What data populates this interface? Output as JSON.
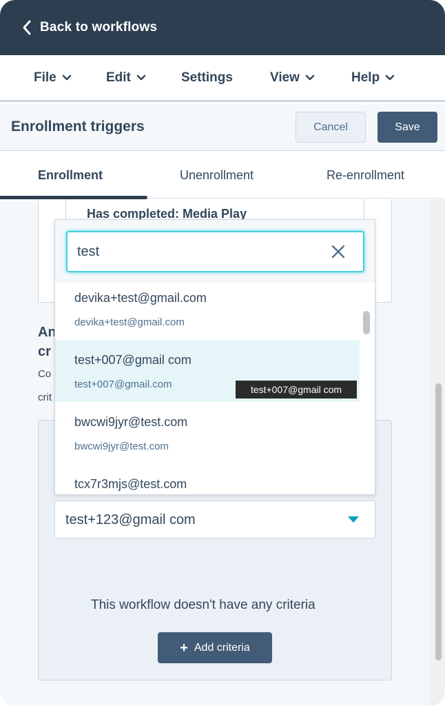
{
  "topbar": {
    "back_label": "Back to workflows"
  },
  "menu": {
    "file": "File",
    "edit": "Edit",
    "settings": "Settings",
    "view": "View",
    "help": "Help"
  },
  "panel": {
    "title": "Enrollment triggers",
    "cancel_label": "Cancel",
    "save_label": "Save"
  },
  "tabs": {
    "enrollment": "Enrollment",
    "unenrollment": "Unenrollment",
    "reenrollment": "Re-enrollment"
  },
  "card1": {
    "text": "Has completed: Media Play"
  },
  "clipped": {
    "heading_line1": "An",
    "heading_line2": "cr",
    "sub_line1": "Co",
    "sub_line2": "crit"
  },
  "search": {
    "value": "test"
  },
  "dropdown_items": [
    {
      "primary": "devika+test@gmail.com",
      "secondary": "devika+test@gmail.com"
    },
    {
      "primary": "test+007@gmail com",
      "secondary": "test+007@gmail.com"
    },
    {
      "primary": "bwcwi9jyr@test.com",
      "secondary": "bwcwi9jyr@test.com"
    },
    {
      "primary": "tcx7r3mjs@test.com",
      "secondary": ""
    }
  ],
  "tooltip": "test+007@gmail com",
  "select": {
    "value": "test+123@gmail com"
  },
  "criteria": {
    "empty_text": "This workflow doesn't have any criteria",
    "add_label": "Add criteria",
    "add_icon": "+"
  },
  "colors": {
    "header_bg": "#2d3e50",
    "accent": "#00bda5",
    "focus": "#48cfe0",
    "button_dark": "#425b76",
    "highlight_row": "#e5f5f8"
  }
}
